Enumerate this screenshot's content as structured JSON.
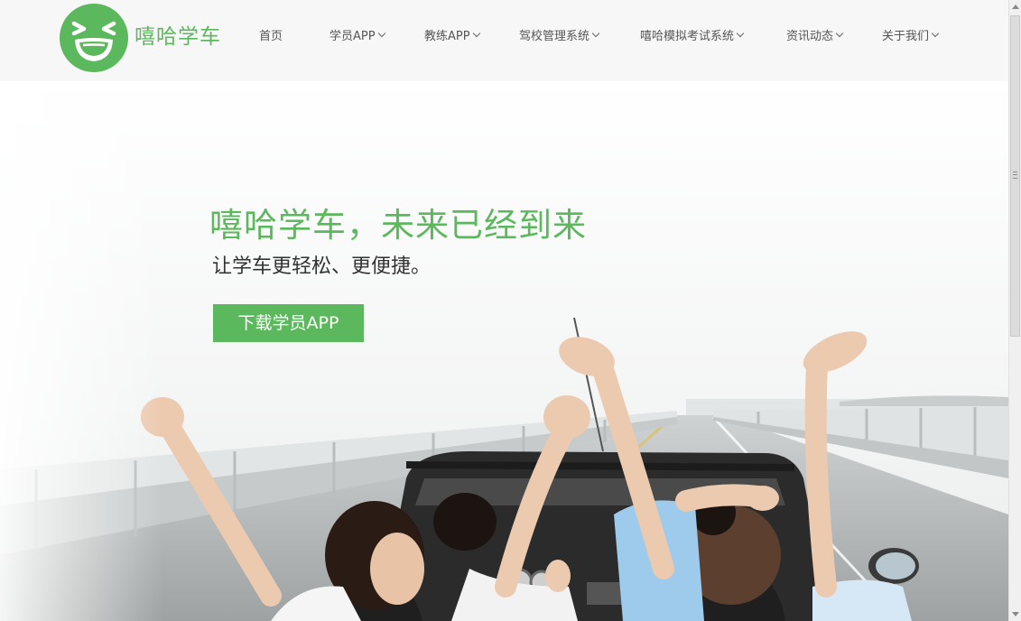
{
  "brand": {
    "name": "嘻哈学车",
    "logo_icon": "smiley-face-logo",
    "color": "#5cb85c"
  },
  "nav": {
    "items": [
      {
        "label": "首页",
        "has_dropdown": false
      },
      {
        "label": "学员APP",
        "has_dropdown": true
      },
      {
        "label": "教练APP",
        "has_dropdown": true
      },
      {
        "label": "驾校管理系统",
        "has_dropdown": true
      },
      {
        "label": "嘻哈模拟考试系统",
        "has_dropdown": true
      },
      {
        "label": "资讯动态",
        "has_dropdown": true
      },
      {
        "label": "关于我们",
        "has_dropdown": true
      }
    ]
  },
  "hero": {
    "title": "嘻哈学车，未来已经到来",
    "subtitle": "让学车更轻松、更便捷。",
    "button_label": "下载学员APP",
    "image": "people-cheering-in-convertible-car-on-bridge"
  },
  "colors": {
    "accent": "#5cb85c",
    "header_bg": "#f7f7f7",
    "nav_text": "#555555"
  }
}
